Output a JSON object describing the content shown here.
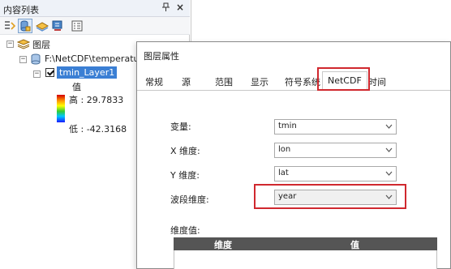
{
  "toc": {
    "title": "内容列表",
    "pin_glyph": "ᵖ",
    "close_glyph": "×",
    "root_label": "图层",
    "path_label": "F:\\NetCDF\\temperature",
    "layer_label": "tmin_Layer1",
    "legend_heading": "值",
    "legend_high": "高 : 29.7833",
    "legend_low": "低 : -42.3168"
  },
  "dialog": {
    "title": "图层属性",
    "tabs": [
      "常规",
      "源",
      "范围",
      "显示",
      "符号系统",
      "NetCDF",
      "时间"
    ],
    "active_tab": "NetCDF",
    "fields": [
      {
        "label": "变量:",
        "value": "tmin"
      },
      {
        "label": "X 维度:",
        "value": "lon"
      },
      {
        "label": "Y 维度:",
        "value": "lat"
      },
      {
        "label": "波段维度:",
        "value": "year"
      }
    ],
    "dim_values_label": "维度值:",
    "grid_headers": [
      "维度",
      "值"
    ]
  },
  "colors": {
    "highlight": "#d0282e",
    "selection": "#3b7fd4",
    "grid_header": "#555555"
  }
}
